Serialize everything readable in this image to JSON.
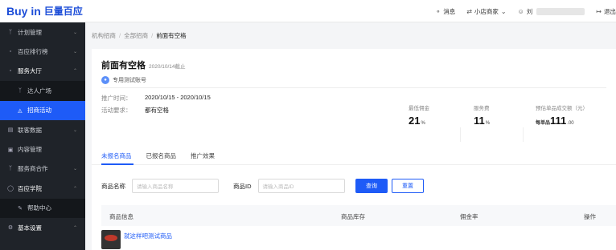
{
  "brand": {
    "name": "Buy in",
    "sub": "巨量百应"
  },
  "topbar": {
    "message": "消息",
    "store": "小店商家",
    "user": "刘",
    "logout": "退出"
  },
  "sidebar": {
    "items": [
      {
        "label": "计划管理",
        "icon": "people-icon"
      },
      {
        "label": "百应排行榜",
        "icon": "chart-icon"
      },
      {
        "label": "服务大厅",
        "icon": "chart-icon"
      },
      {
        "label": "达人广场",
        "icon": "people-icon"
      },
      {
        "label": "招商活动",
        "icon": "megaphone-icon"
      },
      {
        "label": "联客数据",
        "icon": "data-icon"
      },
      {
        "label": "内容管理",
        "icon": "doc-icon"
      },
      {
        "label": "服务商合作",
        "icon": "people-icon"
      },
      {
        "label": "百应学院",
        "icon": "bulb-icon"
      },
      {
        "label": "帮助中心",
        "icon": "edit-icon"
      },
      {
        "label": "基本设置",
        "icon": "gear-icon"
      }
    ]
  },
  "breadcrumb": {
    "items": [
      "机构招商",
      "全部招商",
      "前面有空格"
    ],
    "sep": "/"
  },
  "activity": {
    "title": "前面有空格",
    "deadline": "2020/10/14截止",
    "account": "专用测试账号",
    "promo_label": "推广时间：",
    "promo_value": "2020/10/15 - 2020/10/15",
    "req_label": "活动要求：",
    "req_value": "都有空格"
  },
  "stats": [
    {
      "label": "最低佣金",
      "value": "21",
      "unit": "%"
    },
    {
      "label": "服务费",
      "value": "11",
      "unit": "%"
    },
    {
      "label": "预估单品成交额（元）",
      "prefix": "每单品",
      "value": "111",
      "unit": ".00"
    }
  ],
  "tabs": [
    "未报名商品",
    "已报名商品",
    "推广效果"
  ],
  "filters": {
    "name_label": "商品名称",
    "name_placeholder": "请输入商品名称",
    "id_label": "商品ID",
    "id_placeholder": "请输入商品ID",
    "query_btn": "查询",
    "reset_btn": "重置"
  },
  "table": {
    "headers": [
      "商品信息",
      "商品库存",
      "佣金率",
      "操作"
    ],
    "rows": [
      {
        "name": "就这样吧测试商品"
      }
    ]
  },
  "colors": {
    "accent": "#1e5bf7",
    "sidebar": "#1f2329"
  }
}
